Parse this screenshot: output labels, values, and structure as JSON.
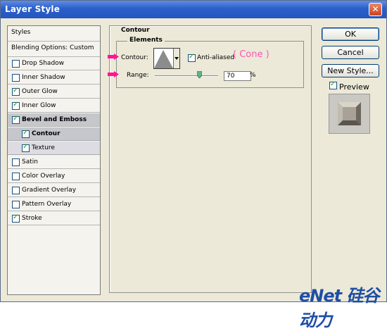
{
  "window": {
    "title": "Layer Style",
    "close_icon": "close-icon"
  },
  "styles_list": {
    "header": "Styles",
    "blending": "Blending Options: Custom",
    "items": [
      {
        "label": "Drop Shadow",
        "checked": false
      },
      {
        "label": "Inner Shadow",
        "checked": false
      },
      {
        "label": "Outer Glow",
        "checked": true
      },
      {
        "label": "Inner Glow",
        "checked": true
      },
      {
        "label": "Bevel and Emboss",
        "checked": true
      },
      {
        "label": "Contour",
        "checked": true
      },
      {
        "label": "Texture",
        "checked": true
      },
      {
        "label": "Satin",
        "checked": false
      },
      {
        "label": "Color Overlay",
        "checked": false
      },
      {
        "label": "Gradient Overlay",
        "checked": false
      },
      {
        "label": "Pattern Overlay",
        "checked": false
      },
      {
        "label": "Stroke",
        "checked": true
      }
    ]
  },
  "panel": {
    "section": "Contour",
    "group": "Elements",
    "contour_label": "Contour:",
    "anti_aliased": "Anti-aliased",
    "anti_aliased_checked": true,
    "annotation": "( Cone )",
    "range_label": "Range:",
    "range_value": "70",
    "range_unit": "%"
  },
  "buttons": {
    "ok": "OK",
    "cancel": "Cancel",
    "new_style": "New Style..."
  },
  "preview": {
    "label": "Preview",
    "checked": true
  },
  "watermark": "eNet 硅谷动力",
  "colors": {
    "titlebar": "#2a5fc9",
    "annotation": "#ff54b5",
    "arrow": "#ff1493",
    "selected_row": "#c6c6cd"
  }
}
